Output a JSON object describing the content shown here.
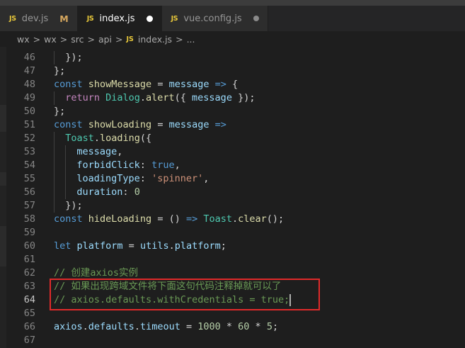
{
  "tabs": [
    {
      "icon": "JS",
      "label": "dev.js",
      "status": "M",
      "active": false
    },
    {
      "icon": "JS",
      "label": "index.js",
      "status": "●",
      "active": true
    },
    {
      "icon": "JS",
      "label": "vue.config.js",
      "status": "●",
      "active": false
    }
  ],
  "breadcrumb": {
    "parts": [
      "wx",
      "wx",
      "src",
      "api"
    ],
    "file_icon": "JS",
    "file": "index.js",
    "ellipsis": "...",
    "separator": ">"
  },
  "editor": {
    "current_line": 64,
    "lines": [
      {
        "num": "46",
        "indent": 1,
        "tokens": [
          {
            "t": "});",
            "c": "pun"
          }
        ]
      },
      {
        "num": "47",
        "indent": 0,
        "tokens": [
          {
            "t": "};",
            "c": "pun"
          }
        ]
      },
      {
        "num": "48",
        "indent": 0,
        "tokens": [
          {
            "t": "const ",
            "c": "kw"
          },
          {
            "t": "showMessage",
            "c": "fn"
          },
          {
            "t": " = ",
            "c": "pun"
          },
          {
            "t": "message",
            "c": "var"
          },
          {
            "t": " => ",
            "c": "kw"
          },
          {
            "t": "{",
            "c": "pun"
          }
        ]
      },
      {
        "num": "49",
        "indent": 1,
        "tokens": [
          {
            "t": "return ",
            "c": "ctrl"
          },
          {
            "t": "Dialog",
            "c": "cls"
          },
          {
            "t": ".",
            "c": "pun"
          },
          {
            "t": "alert",
            "c": "fn"
          },
          {
            "t": "({ ",
            "c": "pun"
          },
          {
            "t": "message",
            "c": "var"
          },
          {
            "t": " });",
            "c": "pun"
          }
        ]
      },
      {
        "num": "50",
        "indent": 0,
        "tokens": [
          {
            "t": "};",
            "c": "pun"
          }
        ]
      },
      {
        "num": "51",
        "indent": 0,
        "tokens": [
          {
            "t": "const ",
            "c": "kw"
          },
          {
            "t": "showLoading",
            "c": "fn"
          },
          {
            "t": " = ",
            "c": "pun"
          },
          {
            "t": "message",
            "c": "var"
          },
          {
            "t": " =>",
            "c": "kw"
          }
        ]
      },
      {
        "num": "52",
        "indent": 1,
        "tokens": [
          {
            "t": "Toast",
            "c": "cls"
          },
          {
            "t": ".",
            "c": "pun"
          },
          {
            "t": "loading",
            "c": "fn"
          },
          {
            "t": "({",
            "c": "pun"
          }
        ]
      },
      {
        "num": "53",
        "indent": 2,
        "tokens": [
          {
            "t": "message",
            "c": "var"
          },
          {
            "t": ",",
            "c": "pun"
          }
        ]
      },
      {
        "num": "54",
        "indent": 2,
        "tokens": [
          {
            "t": "forbidClick",
            "c": "var"
          },
          {
            "t": ": ",
            "c": "pun"
          },
          {
            "t": "true",
            "c": "kw"
          },
          {
            "t": ",",
            "c": "pun"
          }
        ]
      },
      {
        "num": "55",
        "indent": 2,
        "tokens": [
          {
            "t": "loadingType",
            "c": "var"
          },
          {
            "t": ": ",
            "c": "pun"
          },
          {
            "t": "'spinner'",
            "c": "str"
          },
          {
            "t": ",",
            "c": "pun"
          }
        ]
      },
      {
        "num": "56",
        "indent": 2,
        "tokens": [
          {
            "t": "duration",
            "c": "var"
          },
          {
            "t": ": ",
            "c": "pun"
          },
          {
            "t": "0",
            "c": "num"
          }
        ]
      },
      {
        "num": "57",
        "indent": 1,
        "tokens": [
          {
            "t": "});",
            "c": "pun"
          }
        ]
      },
      {
        "num": "58",
        "indent": 0,
        "tokens": [
          {
            "t": "const ",
            "c": "kw"
          },
          {
            "t": "hideLoading",
            "c": "fn"
          },
          {
            "t": " = () ",
            "c": "pun"
          },
          {
            "t": "=>",
            "c": "kw"
          },
          {
            "t": " ",
            "c": "pun"
          },
          {
            "t": "Toast",
            "c": "cls"
          },
          {
            "t": ".",
            "c": "pun"
          },
          {
            "t": "clear",
            "c": "fn"
          },
          {
            "t": "();",
            "c": "pun"
          }
        ]
      },
      {
        "num": "59",
        "indent": 0,
        "tokens": []
      },
      {
        "num": "60",
        "indent": 0,
        "tokens": [
          {
            "t": "let ",
            "c": "kw"
          },
          {
            "t": "platform",
            "c": "var"
          },
          {
            "t": " = ",
            "c": "pun"
          },
          {
            "t": "utils",
            "c": "var"
          },
          {
            "t": ".",
            "c": "pun"
          },
          {
            "t": "platform",
            "c": "var"
          },
          {
            "t": ";",
            "c": "pun"
          }
        ]
      },
      {
        "num": "61",
        "indent": 0,
        "tokens": []
      },
      {
        "num": "62",
        "indent": 0,
        "tokens": [
          {
            "t": "// 创建axios实例",
            "c": "com"
          }
        ]
      },
      {
        "num": "63",
        "indent": 0,
        "tokens": [
          {
            "t": "// 如果出现跨域文件将下面这句代码注释掉就可以了",
            "c": "com"
          }
        ]
      },
      {
        "num": "64",
        "indent": 0,
        "tokens": [
          {
            "t": "// axios.defaults.withCredentials = true;",
            "c": "com"
          }
        ]
      },
      {
        "num": "65",
        "indent": 0,
        "tokens": []
      },
      {
        "num": "66",
        "indent": 0,
        "tokens": [
          {
            "t": "axios",
            "c": "var"
          },
          {
            "t": ".",
            "c": "pun"
          },
          {
            "t": "defaults",
            "c": "var"
          },
          {
            "t": ".",
            "c": "pun"
          },
          {
            "t": "timeout",
            "c": "var"
          },
          {
            "t": " = ",
            "c": "pun"
          },
          {
            "t": "1000",
            "c": "num"
          },
          {
            "t": " * ",
            "c": "pun"
          },
          {
            "t": "60",
            "c": "num"
          },
          {
            "t": " * ",
            "c": "pun"
          },
          {
            "t": "5",
            "c": "num"
          },
          {
            "t": ";",
            "c": "pun"
          }
        ]
      },
      {
        "num": "67",
        "indent": 0,
        "tokens": []
      }
    ]
  },
  "colors": {
    "accent_highlight_box": "#e02a2a",
    "keyword": "#569cd6",
    "comment": "#6a9955",
    "string": "#ce9178"
  }
}
